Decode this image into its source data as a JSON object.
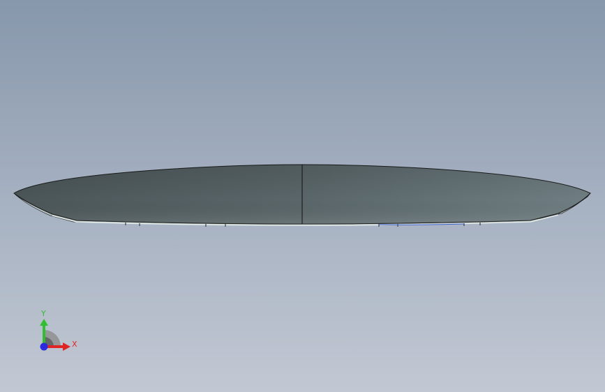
{
  "viewport": {
    "background_top": "#8797ab",
    "background_bottom": "#c2c8d3"
  },
  "model": {
    "face_color_left": "#4e5a5d",
    "face_color_right": "#66767a",
    "edge_color": "#1a1a1a",
    "rim_color": "#dfe8e6"
  },
  "triad": {
    "x_label": "X",
    "y_label": "Y",
    "x_color": "#e02424",
    "y_color": "#2fbf2f",
    "z_color": "#2a2ae0"
  }
}
